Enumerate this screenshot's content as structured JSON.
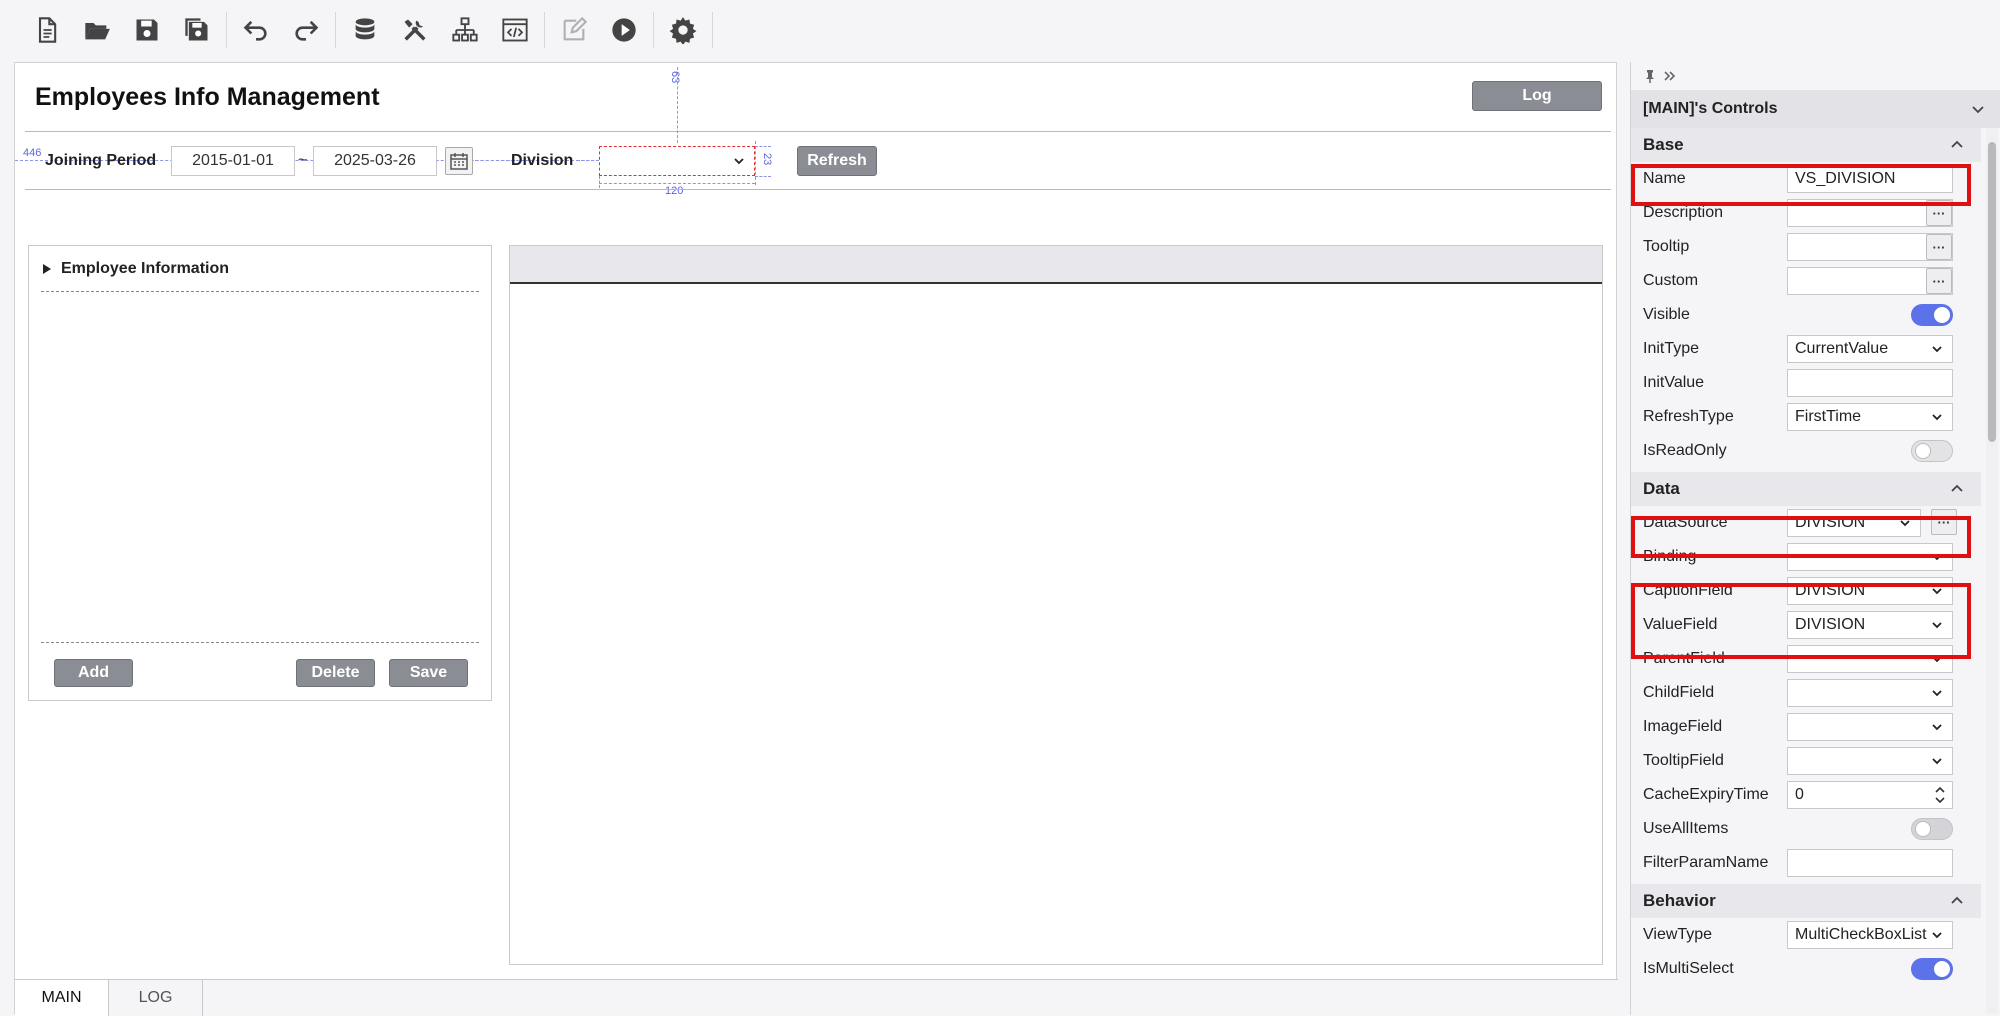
{
  "toolbar": {
    "items": [
      "new-file-icon",
      "open-folder-icon",
      "save-icon",
      "save-all-icon",
      "undo-icon",
      "redo-icon",
      "database-icon",
      "tools-icon",
      "hierarchy-icon",
      "code-icon",
      "edit-icon",
      "run-icon",
      "gear-icon"
    ]
  },
  "canvas": {
    "title": "Employees Info Management",
    "log_button": "Log",
    "joining_period_label": "Joining Period",
    "date_from": "2015-01-01",
    "date_sep": "~",
    "date_to": "2025-03-26",
    "division_label": "Division",
    "division_value": "",
    "refresh_button": "Refresh",
    "guide_top": "63",
    "guide_left": "446",
    "guide_height": "23",
    "guide_width": "120",
    "info_panel": {
      "header": "Employee Information",
      "add": "Add",
      "delete": "Delete",
      "save": "Save"
    },
    "tabs": [
      "MAIN",
      "LOG"
    ]
  },
  "props": {
    "title": "[MAIN]'s Controls",
    "sections": {
      "base": "Base",
      "data": "Data",
      "behavior": "Behavior"
    },
    "base": {
      "name_label": "Name",
      "name_value": "VS_DIVISION",
      "description_label": "Description",
      "description_value": "",
      "tooltip_label": "Tooltip",
      "tooltip_value": "",
      "custom_label": "Custom",
      "custom_value": "",
      "visible_label": "Visible",
      "visible_on": true,
      "inittype_label": "InitType",
      "inittype_value": "CurrentValue",
      "initvalue_label": "InitValue",
      "initvalue_value": "",
      "refreshtype_label": "RefreshType",
      "refreshtype_value": "FirstTime",
      "isreadonly_label": "IsReadOnly",
      "isreadonly_on": false
    },
    "data": {
      "datasource_label": "DataSource",
      "datasource_value": "DIVISION",
      "binding_label": "Binding",
      "binding_value": "",
      "captionfield_label": "CaptionField",
      "captionfield_value": "DIVISION",
      "valuefield_label": "ValueField",
      "valuefield_value": "DIVISION",
      "parentfield_label": "ParentField",
      "parentfield_value": "",
      "childfield_label": "ChildField",
      "childfield_value": "",
      "imagefield_label": "ImageField",
      "imagefield_value": "",
      "tooltipfield_label": "TooltipField",
      "tooltipfield_value": "",
      "cacheexpirytime_label": "CacheExpiryTime",
      "cacheexpirytime_value": "0",
      "useallitems_label": "UseAllItems",
      "useallitems_on": false,
      "filterparamname_label": "FilterParamName",
      "filterparamname_value": ""
    },
    "behavior": {
      "viewtype_label": "ViewType",
      "viewtype_value": "MultiCheckBoxList",
      "ismultiselect_label": "IsMultiSelect",
      "ismultiselect_on": true
    },
    "colors": {
      "highlight": "#e01010",
      "accent": "#5b72e8",
      "button": "#8a8d93"
    }
  }
}
